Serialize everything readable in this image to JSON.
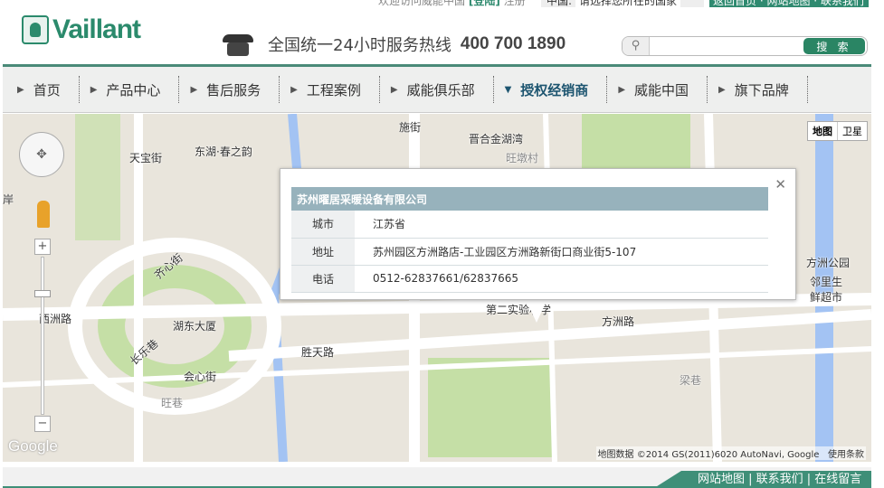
{
  "topbar": {
    "welcome": "欢迎访问威能中国",
    "login": "[登陆]",
    "register": "注册",
    "country_label": "中国:",
    "country_value": "请选择您所在的国家",
    "links": "返回首页 · 网站地图 · 联系我们"
  },
  "logo": "Vaillant",
  "hotline": {
    "label": "全国统一24小时服务热线",
    "number": "400 700 1890"
  },
  "search": {
    "value": "",
    "button": "搜 索"
  },
  "nav": [
    {
      "label": "首页"
    },
    {
      "label": "产品中心"
    },
    {
      "label": "售后服务"
    },
    {
      "label": "工程案例"
    },
    {
      "label": "威能俱乐部"
    },
    {
      "label": "授权经销商",
      "active": true
    },
    {
      "label": "威能中国"
    },
    {
      "label": "旗下品牌"
    }
  ],
  "map": {
    "type_map": "地图",
    "type_sat": "卫星",
    "labels": [
      "天宝街",
      "东湖·春之韵",
      "晋合金湖湾",
      "旺墩村",
      "施街",
      "湖东大厦",
      "齐心街",
      "西洲路",
      "长乐巷",
      "会心街",
      "旺巷",
      "胜天路",
      "方洲路",
      "第二实验小学",
      "方洲公园",
      "邻里生鲜超市",
      "梁巷",
      "岸"
    ],
    "copyright": "地图数据 ©2014 GS(2011)6020 AutoNavi, Google",
    "terms": "使用条款",
    "google": "Google"
  },
  "info": {
    "company": "苏州曜居采暖设备有限公司",
    "rows": [
      {
        "k": "城市",
        "v": "江苏省"
      },
      {
        "k": "地址",
        "v": "苏州园区方洲路店-工业园区方洲路新街口商业街5-107"
      },
      {
        "k": "电话",
        "v": "0512-62837661/62837665"
      }
    ]
  },
  "footer": {
    "links": "网站地图 | 联系我们 | 在线留言"
  },
  "colors": {
    "brand": "#2b8a6c",
    "nav_active": "#1d5570",
    "info_header": "#97b2bc"
  }
}
